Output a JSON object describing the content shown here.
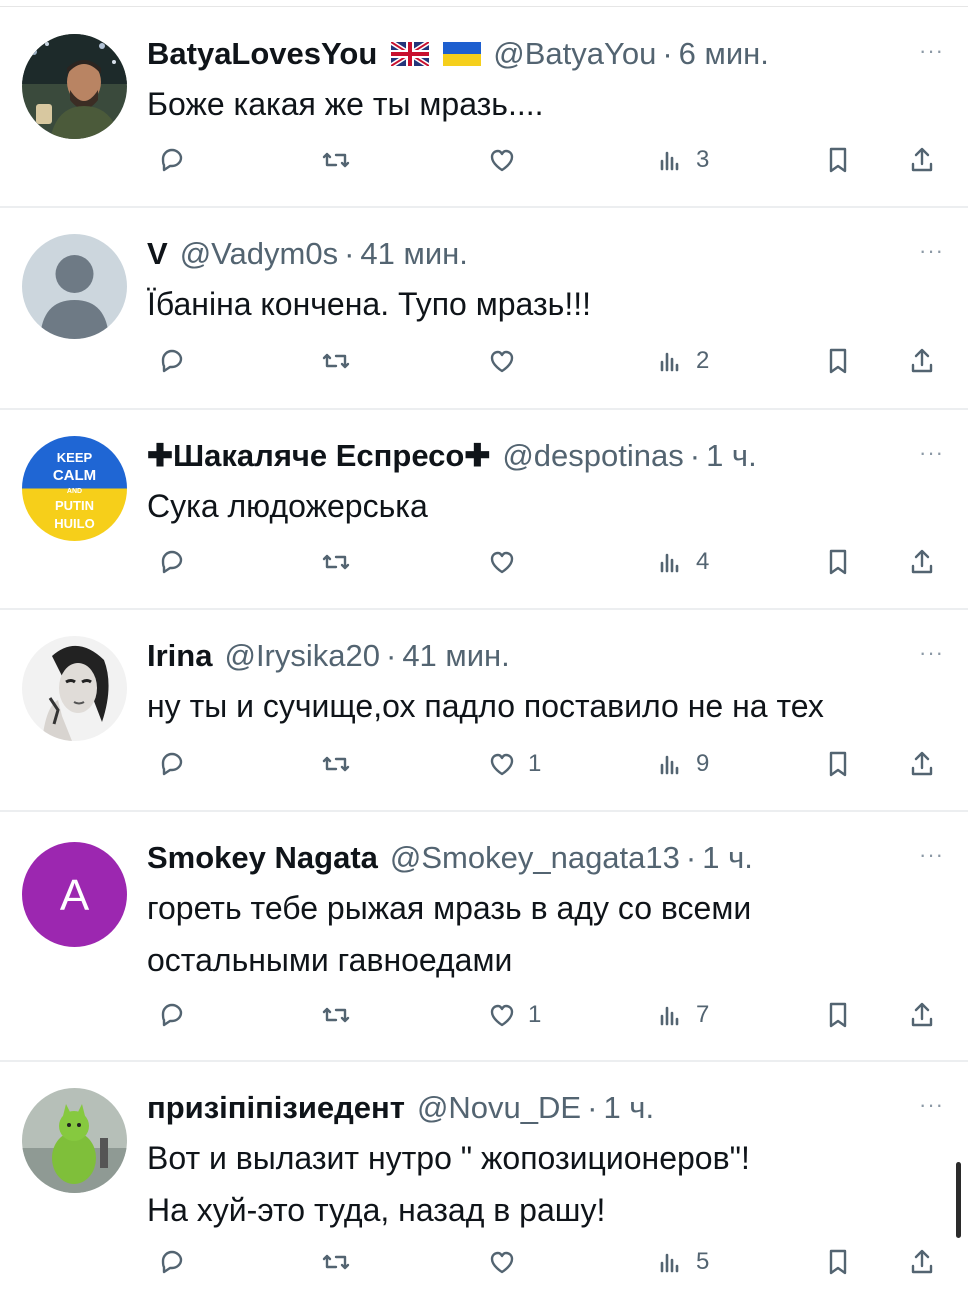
{
  "tweets": [
    {
      "name": "BatyaLovesYou",
      "handle": "@BatyaYou",
      "time": "6 мин.",
      "text_lines": [
        "Боже какая же ты мразь...."
      ],
      "flags": [
        "uk-flag",
        "ukraine-flag"
      ],
      "avatar": "photo-man-avatar",
      "replies": "",
      "retweets": "",
      "likes": "",
      "views": "3"
    },
    {
      "name": "V",
      "handle": "@Vadym0s",
      "time": "41 мин.",
      "text_lines": [
        "Їбаніна кончена. Тупо мразь!!!"
      ],
      "avatar": "default-user-avatar",
      "replies": "",
      "retweets": "",
      "likes": "",
      "views": "2"
    },
    {
      "name": "✚Шакаляче Еспресо✚",
      "handle": "@despotinas",
      "time": "1 ч.",
      "text_lines": [
        "Сука людожерська"
      ],
      "avatar": "keep-calm-putin-huilo-avatar",
      "avatar_text": [
        "KEEP",
        "CALM",
        "AND",
        "PUTIN",
        "HUILO"
      ],
      "replies": "",
      "retweets": "",
      "likes": "",
      "views": "4"
    },
    {
      "name": "Irina",
      "handle": "@Irysika20",
      "time": "41 мин.",
      "text_lines": [
        "ну ты и сучище,ох падло поставило не на тех"
      ],
      "avatar": "woman-portrait-avatar",
      "replies": "",
      "retweets": "",
      "likes": "1",
      "views": "9"
    },
    {
      "name": "Smokey Nagata",
      "handle": "@Smokey_nagata13",
      "time": "1 ч.",
      "text_lines": [
        "гореть тебе рыжая мразь в аду со всеми",
        "остальными гавноедами"
      ],
      "avatar": "letter-avatar",
      "avatar_letter": "A",
      "replies": "",
      "retweets": "",
      "likes": "1",
      "views": "7"
    },
    {
      "name": "призіпіпізиедент",
      "handle": "@Novu_DE",
      "time": "1 ч.",
      "text_lines": [
        "Вот и вылазит нутро \" жопозиционеров\"!",
        "На хуй-это туда, назад в рашу!"
      ],
      "avatar": "green-cat-avatar",
      "replies": "",
      "retweets": "",
      "likes": "",
      "views": "5"
    }
  ],
  "more_label": "···",
  "separator": "·",
  "colors": {
    "text": "#0f1419",
    "secondary": "#536471",
    "letter_avatar": "#9c27b0"
  },
  "icons": [
    "reply-icon",
    "retweet-icon",
    "like-icon",
    "views-icon",
    "bookmark-icon",
    "share-icon"
  ]
}
